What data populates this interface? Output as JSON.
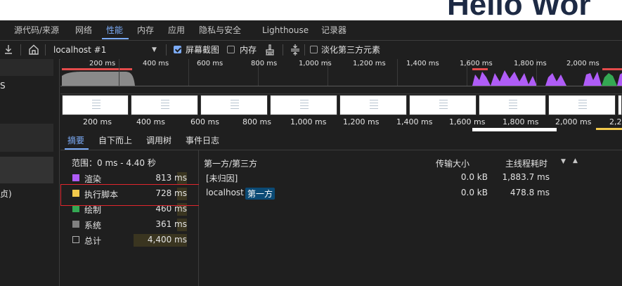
{
  "page": {
    "heading": "Hello Wor"
  },
  "main_tabs": [
    {
      "label": "源代码/来源"
    },
    {
      "label": "网络"
    },
    {
      "label": "性能"
    },
    {
      "label": "内存"
    },
    {
      "label": "应用"
    },
    {
      "label": "隐私与安全"
    },
    {
      "label": "Lighthouse"
    },
    {
      "label": "记录器"
    }
  ],
  "toolbar": {
    "recording_select": "localhost #1",
    "screenshots_label": "屏幕截图",
    "screenshots_checked": true,
    "memory_label": "内存",
    "memory_checked": false,
    "dim_third_party_label": "淡化第三方元素",
    "dim_third_party_checked": false
  },
  "sidebar": {
    "fragment_1": "S",
    "fragment_2": "贞)"
  },
  "overview": {
    "top_ticks": [
      "200 ms",
      "400 ms",
      "600 ms",
      "800 ms",
      "1,000 ms",
      "1,200 ms",
      "1,400 ms",
      "1,600 ms",
      "1,800 ms",
      "2,000 ms"
    ],
    "bottom_ticks": [
      "200 ms",
      "400 ms",
      "600 ms",
      "800 ms",
      "1,000 ms",
      "1,200 ms",
      "1,400 ms",
      "1,600 ms",
      "1,800 ms",
      "2,000 ms",
      "2,20"
    ]
  },
  "bottom_tabs": [
    {
      "label": "摘要"
    },
    {
      "label": "自下而上"
    },
    {
      "label": "调用树"
    },
    {
      "label": "事件日志"
    }
  ],
  "summary": {
    "range": "范围：0 ms - 4.40 秒",
    "rows": [
      {
        "label": "渲染",
        "value": "813 ms",
        "color": "#af5cf7"
      },
      {
        "label": "执行脚本",
        "value": "728 ms",
        "color": "#f2c94c"
      },
      {
        "label": "绘制",
        "value": "460 ms",
        "color": "#34a853"
      },
      {
        "label": "系统",
        "value": "361 ms",
        "color": "#808080"
      },
      {
        "label": "总计",
        "value": "4,400 ms",
        "color": ""
      }
    ]
  },
  "table": {
    "headers": [
      "第一方/第三方",
      "传输大小",
      "主线程耗时"
    ],
    "rows": [
      {
        "name": "[未归因]",
        "badge": "",
        "size": "0.0 kB",
        "time": "1,883.7 ms"
      },
      {
        "name": "localhost",
        "badge": "第一方",
        "size": "0.0 kB",
        "time": "478.8 ms"
      }
    ]
  }
}
